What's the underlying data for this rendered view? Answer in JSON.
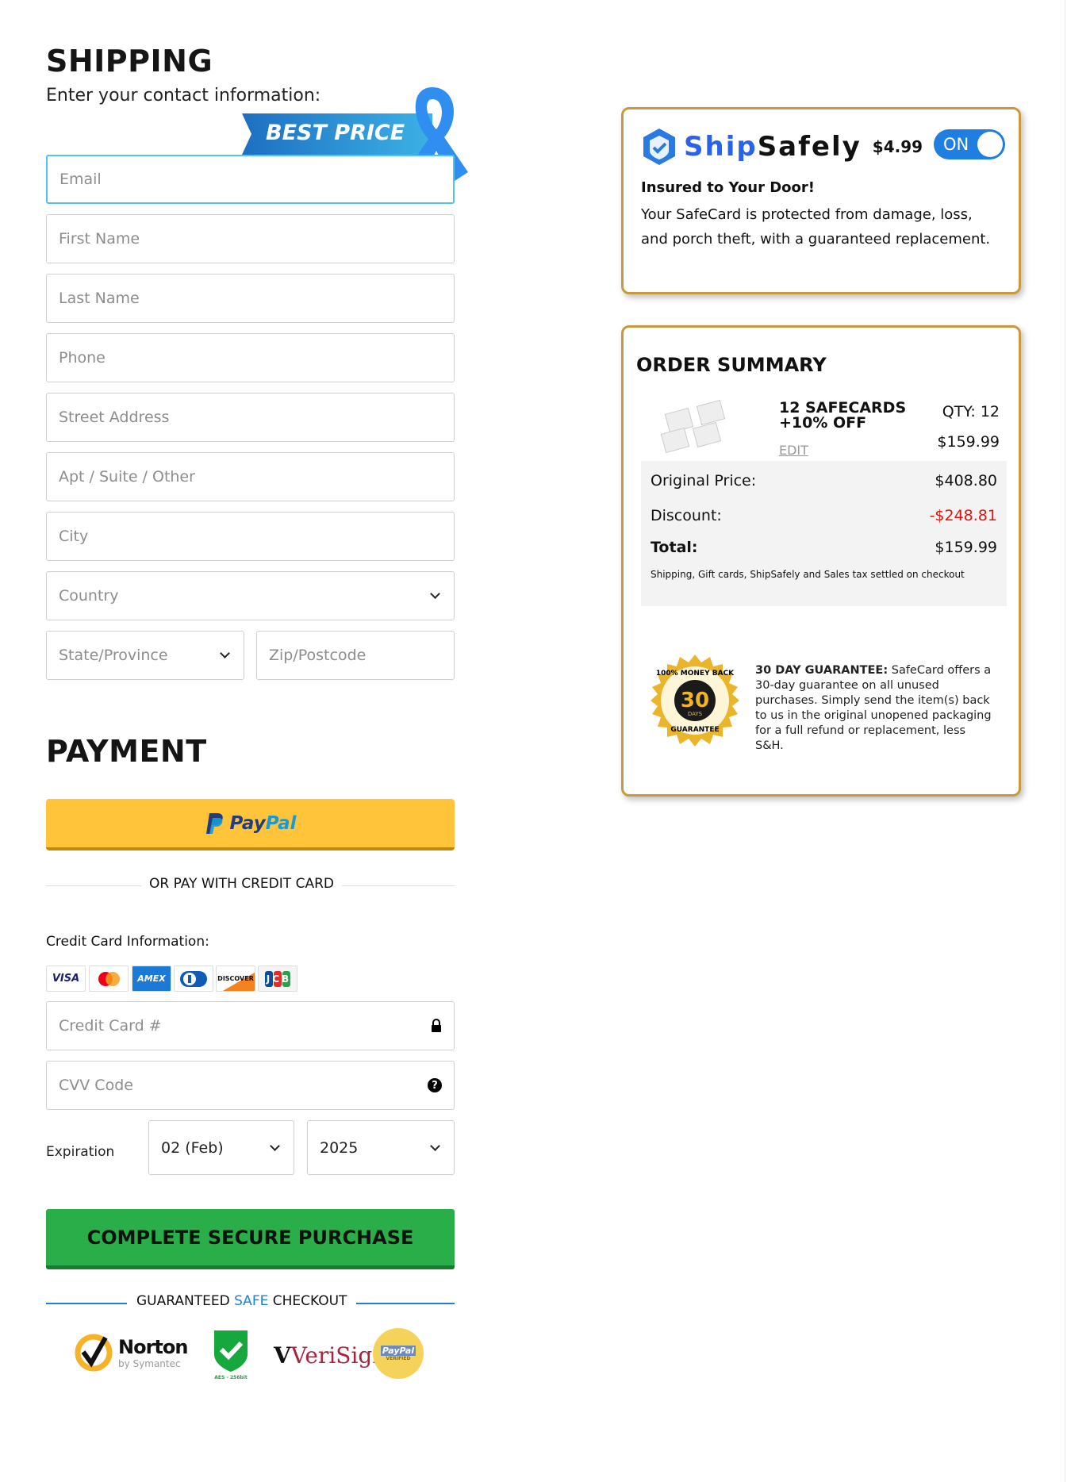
{
  "shipping": {
    "title": "SHIPPING",
    "subtitle": "Enter your contact information:",
    "badge": "BEST PRICE",
    "fields": {
      "email": "Email",
      "first_name": "First Name",
      "last_name": "Last Name",
      "phone": "Phone",
      "street": "Street Address",
      "apt": "Apt / Suite / Other",
      "city": "City",
      "country": "Country",
      "state": "State/Province",
      "zip": "Zip/Postcode"
    }
  },
  "payment": {
    "title": "PAYMENT",
    "paypal_label_pay": "Pay",
    "paypal_label_pal": "Pal",
    "divider": "OR PAY WITH CREDIT CARD",
    "cc_info_label": "Credit Card Information:",
    "card_brands": [
      "VISA",
      "mastercard",
      "AMEX",
      "Diners",
      "DISCOVER",
      "JCB"
    ],
    "cc_number_placeholder": "Credit Card #",
    "cvv_placeholder": "CVV Code",
    "expiration_label": "Expiration",
    "exp_month": "02 (Feb)",
    "exp_year": "2025",
    "submit": "COMPLETE SECURE PURCHASE",
    "safe_pre": "GUARANTEED ",
    "safe_mid": "SAFE",
    "safe_post": " CHECKOUT",
    "trust": {
      "norton": "Norton",
      "norton_sub": "by Symantec",
      "aes": "AES - 256bit",
      "verisign": "VeriSign",
      "paypal_verified_1": "PayPal",
      "paypal_verified_2": "VERIFIED"
    }
  },
  "shipsafely": {
    "brand_ship": "Ship",
    "brand_safely": "Safely",
    "price": "$4.99",
    "toggle": "ON",
    "toggle_on": true,
    "heading": "Insured to Your Door!",
    "body": "Your SafeCard is protected from damage, loss, and porch theft, with a guaranteed replacement."
  },
  "order": {
    "title": "ORDER SUMMARY",
    "product_line1": "12 SAFECARDS",
    "product_line2": "+10% OFF",
    "edit": "EDIT",
    "qty": "QTY: 12",
    "price": "$159.99",
    "original_label": "Original Price:",
    "original_value": "$408.80",
    "discount_label": "Discount:",
    "discount_value": "-$248.81",
    "total_label": "Total:",
    "total_value": "$159.99",
    "note": "Shipping, Gift cards, ShipSafely and Sales tax settled on checkout",
    "guarantee_bold": "30 DAY GUARANTEE:",
    "guarantee_text": " SafeCard offers a 30-day guarantee on all unused purchases. Simply send the item(s) back to us in the original unopened packaging for a full refund or replacement, less S&H.",
    "seal_top": "100% MONEY BACK",
    "seal_num": "30",
    "seal_days": "DAYS",
    "seal_bottom": "GUARANTEE"
  },
  "colors": {
    "gold": "#c99a3c",
    "blue": "#1f7fe0",
    "green": "#28a745",
    "paypal_yellow": "#ffc439",
    "discount_red": "#e3120b"
  }
}
